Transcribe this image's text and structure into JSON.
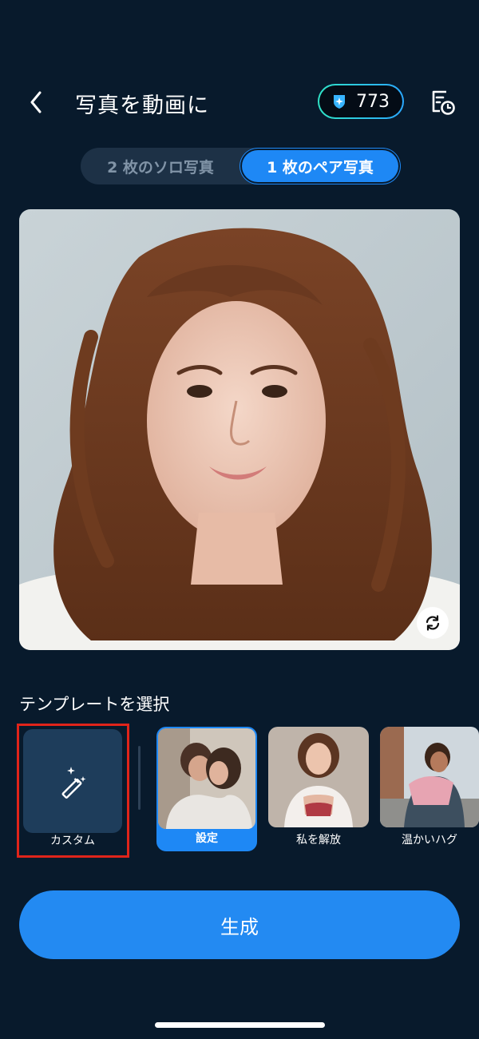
{
  "header": {
    "title": "写真を動画に",
    "credits": "773",
    "back_icon": "chevron-left-icon",
    "credits_icon": "sparkle-shield-icon",
    "history_icon": "history-clock-icon"
  },
  "mode_tabs": [
    {
      "label": "2 枚のソロ写真",
      "active": false
    },
    {
      "label": "1 枚のペア写真",
      "active": true
    }
  ],
  "photo": {
    "swap_icon": "swap-refresh-icon"
  },
  "templates": {
    "section_label": "テンプレートを選択",
    "custom": {
      "label": "カスタム",
      "icon": "magic-wand-icon"
    },
    "items": [
      {
        "label": "設定",
        "selected": true
      },
      {
        "label": "私を解放",
        "selected": false
      },
      {
        "label": "温かいハグ",
        "selected": false
      }
    ]
  },
  "generate": {
    "label": "生成"
  },
  "colors": {
    "background": "#081a2c",
    "accent": "#1e88f5",
    "highlight": "#e0241a",
    "credit_gradient_start": "#2fe3c7",
    "credit_gradient_end": "#2aa8ff"
  }
}
